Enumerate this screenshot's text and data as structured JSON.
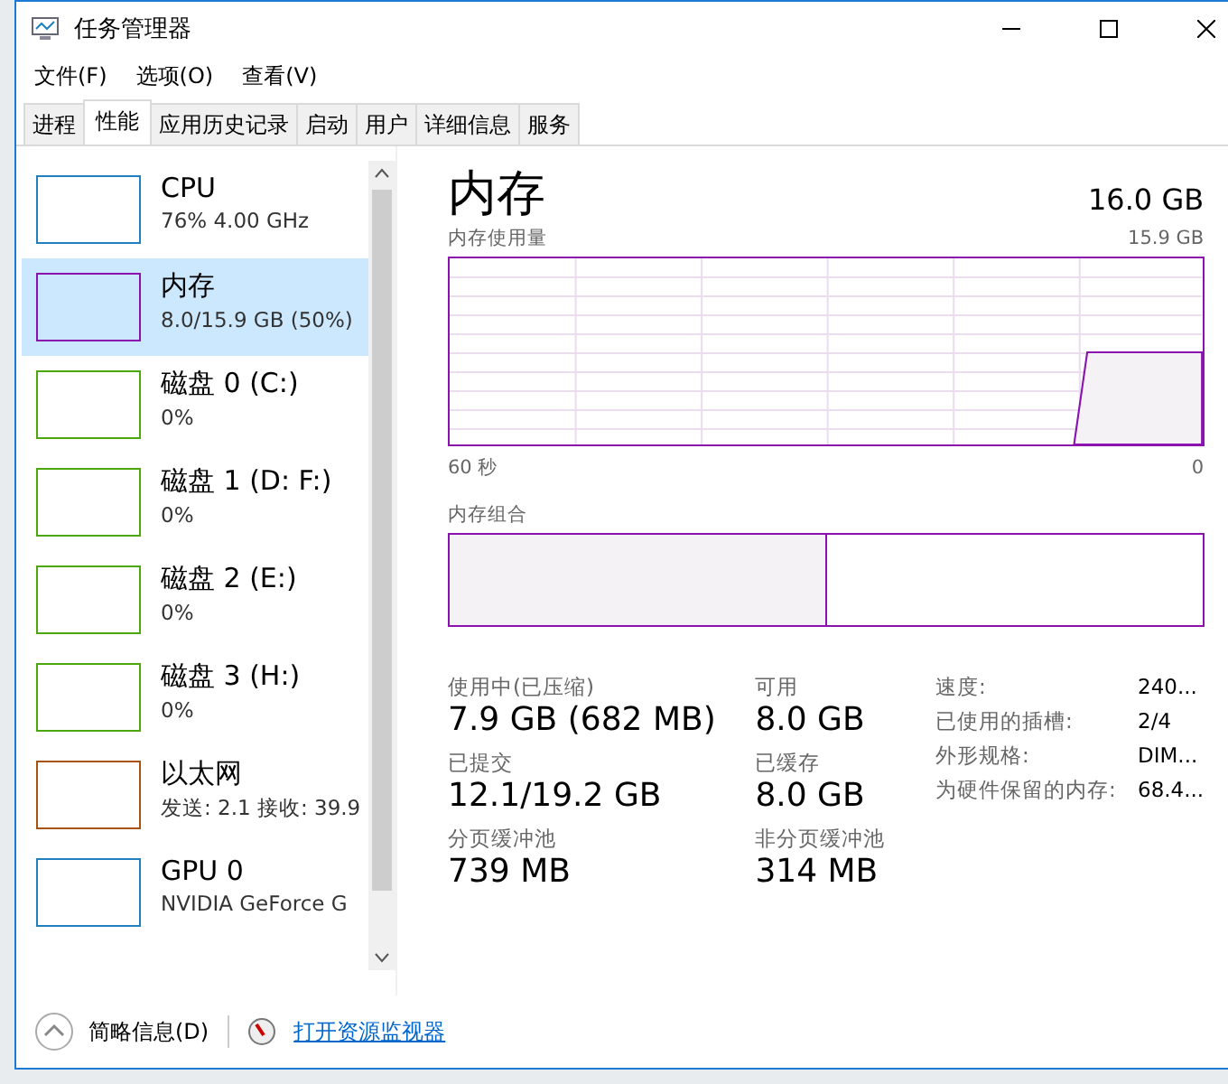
{
  "window": {
    "title": "任务管理器"
  },
  "menu": [
    "文件(F)",
    "选项(O)",
    "查看(V)"
  ],
  "tabs": [
    {
      "label": "进程",
      "selected": false
    },
    {
      "label": "性能",
      "selected": true
    },
    {
      "label": "应用历史记录",
      "selected": false
    },
    {
      "label": "启动",
      "selected": false
    },
    {
      "label": "用户",
      "selected": false
    },
    {
      "label": "详细信息",
      "selected": false
    },
    {
      "label": "服务",
      "selected": false
    }
  ],
  "sidebar": {
    "items": [
      {
        "name": "CPU",
        "detail": "76% 4.00 GHz",
        "color": "#1f7fbf",
        "selected": false
      },
      {
        "name": "内存",
        "detail": "8.0/15.9 GB (50%)",
        "color": "#8b12ae",
        "selected": true
      },
      {
        "name": "磁盘 0 (C:)",
        "detail": "0%",
        "color": "#4da60c",
        "selected": false
      },
      {
        "name": "磁盘 1 (D: F:)",
        "detail": "0%",
        "color": "#4da60c",
        "selected": false
      },
      {
        "name": "磁盘 2 (E:)",
        "detail": "0%",
        "color": "#4da60c",
        "selected": false
      },
      {
        "name": "磁盘 3 (H:)",
        "detail": "0%",
        "color": "#4da60c",
        "selected": false
      },
      {
        "name": "以太网",
        "detail": "发送: 2.1 接收: 39.9",
        "color": "#a7520f",
        "selected": false
      },
      {
        "name": "GPU 0",
        "detail": "NVIDIA GeForce G",
        "color": "#1f7fbf",
        "selected": false
      }
    ]
  },
  "main": {
    "title": "内存",
    "total": "16.0 GB",
    "usage_label": "内存使用量",
    "usage_max": "15.9 GB",
    "time_start": "60 秒",
    "time_end": "0",
    "composition_label": "内存组合",
    "composition": {
      "level": 0.5
    },
    "stats": [
      {
        "label": "使用中(已压缩)",
        "value": "7.9 GB (682 MB)"
      },
      {
        "label": "可用",
        "value": "8.0 GB"
      },
      {
        "label": "已提交",
        "value": "12.1/19.2 GB"
      },
      {
        "label": "已缓存",
        "value": "8.0 GB"
      },
      {
        "label": "分页缓冲池",
        "value": "739 MB"
      },
      {
        "label": "非分页缓冲池",
        "value": "314 MB"
      }
    ],
    "details": [
      {
        "label": "速度:",
        "value": "240..."
      },
      {
        "label": "已使用的插槽:",
        "value": "2/4"
      },
      {
        "label": "外形规格:",
        "value": "DIM..."
      },
      {
        "label": "为硬件保留的内存:",
        "value": "68.4..."
      }
    ]
  },
  "footer": {
    "summary": "简略信息(D)",
    "monitor": "打开资源监视器"
  }
}
